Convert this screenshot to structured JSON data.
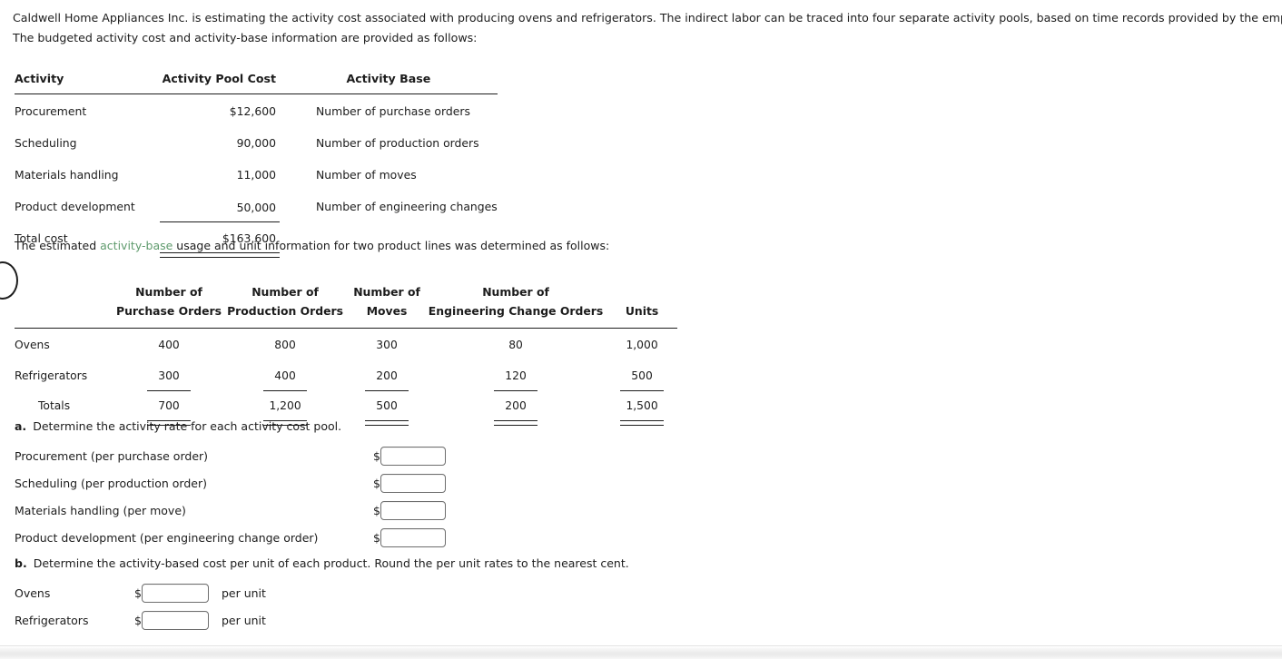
{
  "intro": {
    "line1": "Caldwell Home Appliances Inc. is estimating the activity cost associated with producing ovens and refrigerators. The indirect labor can be traced into four separate activity pools, based on time records provided by the employees.",
    "line2": "The budgeted activity cost and activity-base information are provided as follows:"
  },
  "activity_table": {
    "headers": [
      "Activity",
      "Activity Pool Cost",
      "Activity Base"
    ],
    "rows": [
      {
        "activity": "Procurement",
        "cost": "$12,600",
        "base": "Number of purchase orders"
      },
      {
        "activity": "Scheduling",
        "cost": "90,000",
        "base": "Number of production orders"
      },
      {
        "activity": "Materials handling",
        "cost": "11,000",
        "base": "Number of moves"
      },
      {
        "activity": "Product development",
        "cost": "50,000",
        "base": "Number of engineering changes"
      }
    ],
    "total_label": "Total cost",
    "total_value": "$163,600"
  },
  "mid_text": {
    "before": "The estimated ",
    "keyword": "activity-base",
    "after": " usage and unit information for two product lines was determined as follows:"
  },
  "usage_table": {
    "headers": [
      {
        "top": "",
        "bottom": ""
      },
      {
        "top": "Number of",
        "bottom": "Purchase Orders"
      },
      {
        "top": "Number of",
        "bottom": "Production Orders"
      },
      {
        "top": "Number of",
        "bottom": "Moves"
      },
      {
        "top": "Number of",
        "bottom": "Engineering Change Orders"
      },
      {
        "top": "",
        "bottom": "Units"
      }
    ],
    "rows": [
      {
        "name": "Ovens",
        "purchase_orders": "400",
        "production_orders": "800",
        "moves": "300",
        "engineering_change_orders": "80",
        "units": "1,000"
      },
      {
        "name": "Refrigerators",
        "purchase_orders": "300",
        "production_orders": "400",
        "moves": "200",
        "engineering_change_orders": "120",
        "units": "500"
      }
    ],
    "totals": {
      "name": "Totals",
      "purchase_orders": "700",
      "production_orders": "1,200",
      "moves": "500",
      "engineering_change_orders": "200",
      "units": "1,500"
    }
  },
  "question_a": {
    "letter": "a.",
    "text": "Determine the activity rate for each activity cost pool.",
    "currency_symbol": "$",
    "rows": [
      {
        "label": "Procurement (per purchase order)",
        "value": "",
        "placeholder": ""
      },
      {
        "label": "Scheduling (per production order)",
        "value": "",
        "placeholder": ""
      },
      {
        "label": "Materials handling (per move)",
        "value": "",
        "placeholder": ""
      },
      {
        "label": "Product development (per engineering change order)",
        "value": "",
        "placeholder": ""
      }
    ]
  },
  "question_b": {
    "letter": "b.",
    "text": "Determine the activity-based cost per unit of each product. Round the per unit rates to the nearest cent.",
    "currency_symbol": "$",
    "unit_suffix": "per unit",
    "rows": [
      {
        "label": "Ovens",
        "value": "",
        "placeholder": ""
      },
      {
        "label": "Refrigerators",
        "value": "",
        "placeholder": ""
      }
    ]
  },
  "colors": {
    "keyword_green": "#5f9b6d",
    "rule": "#1d1d1d",
    "input_border": "#6e6e6e",
    "text": "#1c1c1c"
  }
}
